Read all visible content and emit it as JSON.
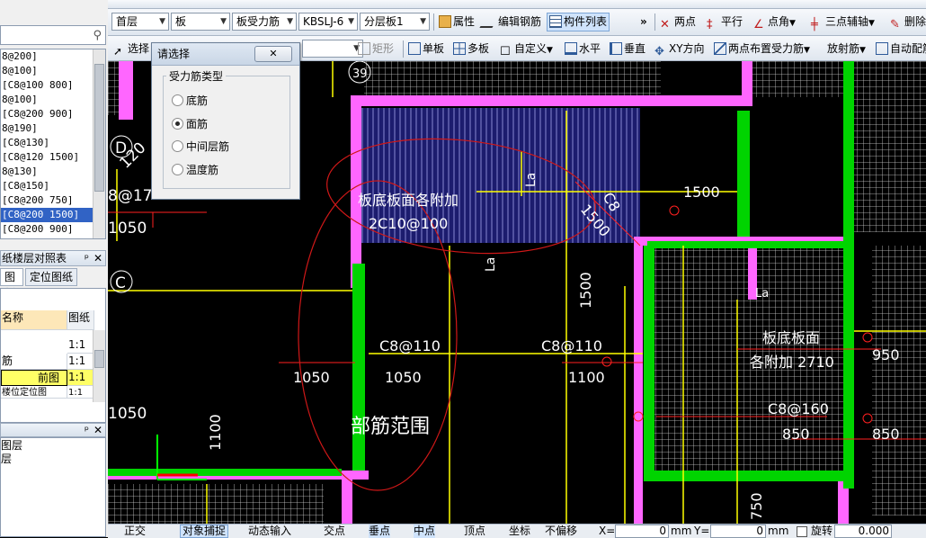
{
  "toolbar1": {
    "floor": "首层",
    "component": "板",
    "subtype": "板受力筋",
    "rebar_name": "KBSLJ-6",
    "layer": "分层板1",
    "attr_label": "属性",
    "edit_rebar_label": "编辑钢筋",
    "component_list_label": "构件列表",
    "more": "»",
    "two_point": "两点",
    "parallel": "平行",
    "point_angle": "点角",
    "three_point_axis": "三点辅轴",
    "delete_axis": "删除"
  },
  "toolbar2": {
    "select": "选择",
    "rect": "矩形",
    "single_board": "单板",
    "multi_board": "多板",
    "custom": "自定义",
    "horizontal": "水平",
    "vertical": "垂直",
    "xy_dir": "XY方向",
    "two_point_layout": "两点布置受力筋",
    "radial": "放射筋",
    "auto_config": "自动配筋"
  },
  "left_list": {
    "items": [
      "8@200]",
      "8@100]",
      "[C8@100 800]",
      "8@100]",
      "[C8@200 900]",
      "8@190]",
      "[C8@130]",
      "[C8@120 1500]",
      "8@130]",
      "[C8@150]",
      "[C8@200 750]",
      "[C8@200 1500]",
      "[C8@200 900]"
    ],
    "selected_index": 11
  },
  "left_panel2": {
    "header": "纸楼层对照表",
    "tab1": "图纸",
    "tab2": "定位图纸",
    "col_name": "名称",
    "col_map": "图纸",
    "row1_val": "1:1",
    "row2_name": "筋",
    "row2_val": "1:1",
    "row3_name": "前图",
    "row3_val": "1:1",
    "row4_name": "楼位定位图",
    "row4_val": "1:1"
  },
  "left_panel3": {
    "line1": "图层",
    "line2": "层"
  },
  "dialog": {
    "title": "请选择",
    "close": "✕",
    "group": "受力筋类型",
    "options": [
      "底筋",
      "面筋",
      "中间层筋",
      "温度筋"
    ],
    "selected": 1
  },
  "cad": {
    "axis_d": "D",
    "axis_c": "C",
    "axis_39": "39",
    "dim_1200": "120",
    "dim_8_17": "8@17",
    "ann_add_bar": "板底板面各附加",
    "ann_2c10": "2C10@100",
    "ann_c8": "C8",
    "ann_1500a": "1500",
    "ann_1500b": "1500",
    "ann_1500v": "1500",
    "ann_la1": "La",
    "ann_la2": "La",
    "ann_c8_110a": "C8@110",
    "ann_c8_110b": "C8@110",
    "ann_1050a": "1050",
    "ann_1050b": "1050",
    "ann_1050c": "1050",
    "ann_1050d": "1050",
    "ann_1100h": "1100",
    "ann_1100v": "1100",
    "ann_range": "部筋范围",
    "ann_add_right1": "板底板面",
    "ann_add_right2": "各附加 2710",
    "ann_c8_160": "C8@160",
    "ann_850a": "850",
    "ann_850b": "850",
    "ann_950": "950",
    "ann_750": "750",
    "ann_la3": "La"
  },
  "status": {
    "ortho": "正交",
    "osnap": "对象捕捉",
    "dyn": "动态输入",
    "intersect": "交点",
    "perp": "垂点",
    "mid": "中点",
    "vertex": "顶点",
    "coord": "坐标",
    "no_offset": "不偏移",
    "x_label": "X=",
    "x_val": "0",
    "mm1": "mm",
    "y_label": "Y=",
    "y_val": "0",
    "mm2": "mm",
    "rotate": "旋转",
    "rot_val": "0.000"
  },
  "colors": {
    "canvas": "#000000",
    "green": "#00e000",
    "magenta": "#ff66ff",
    "yellow": "#ffff00",
    "blue": "#2b2bff",
    "red": "#ff2020"
  }
}
